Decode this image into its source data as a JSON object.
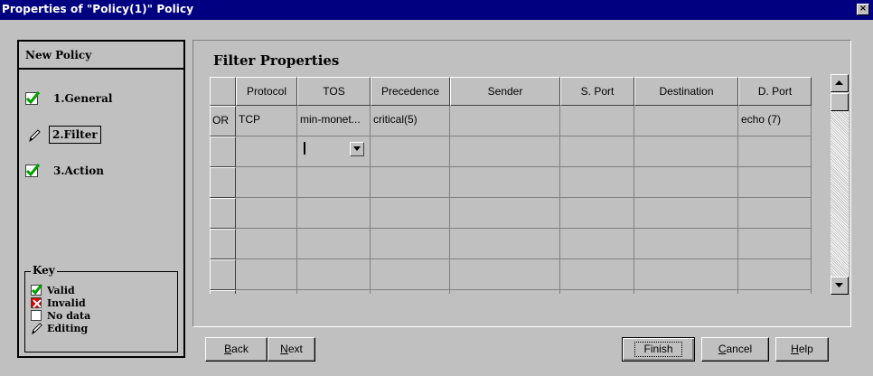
{
  "window": {
    "title": "Properties of \"Policy(1)\" Policy",
    "close_glyph": "×"
  },
  "wizard": {
    "heading": "New Policy",
    "steps": [
      {
        "label": "1.General",
        "status": "valid",
        "icon": "valid-check-icon"
      },
      {
        "label": "2.Filter",
        "status": "editing",
        "icon": "pencil-icon"
      },
      {
        "label": "3.Action",
        "status": "valid",
        "icon": "valid-check-icon"
      }
    ]
  },
  "key": {
    "title": "Key",
    "items": [
      {
        "label": "Valid",
        "icon": "valid-check-icon"
      },
      {
        "label": "Invalid",
        "icon": "invalid-x-icon"
      },
      {
        "label": "No data",
        "icon": "empty-box-icon"
      },
      {
        "label": "Editing",
        "icon": "pencil-icon"
      }
    ]
  },
  "filter": {
    "title": "Filter Properties",
    "columns": [
      "Protocol",
      "TOS",
      "Precedence",
      "Sender",
      "S. Port",
      "Destination",
      "D. Port"
    ],
    "rows": [
      {
        "header": "OR",
        "cells": [
          "TCP",
          "min-monet...",
          "critical(5)",
          "",
          "",
          "",
          "echo (7)"
        ]
      },
      {
        "header": "",
        "cells": [
          "",
          "",
          "",
          "",
          "",
          "",
          ""
        ]
      },
      {
        "header": "",
        "cells": [
          "",
          "",
          "",
          "",
          "",
          "",
          ""
        ]
      },
      {
        "header": "",
        "cells": [
          "",
          "",
          "",
          "",
          "",
          "",
          ""
        ]
      },
      {
        "header": "",
        "cells": [
          "",
          "",
          "",
          "",
          "",
          "",
          ""
        ]
      },
      {
        "header": "",
        "cells": [
          "",
          "",
          "",
          "",
          "",
          "",
          ""
        ]
      },
      {
        "header": "",
        "cells": [
          "",
          "",
          "",
          "",
          "",
          "",
          ""
        ]
      }
    ]
  },
  "buttons": {
    "back": {
      "prefix": "",
      "mnemonic": "B",
      "rest": "ack"
    },
    "next": {
      "prefix": "",
      "mnemonic": "N",
      "rest": "ext"
    },
    "finish": {
      "label": "Finish"
    },
    "cancel": {
      "prefix": "",
      "mnemonic": "C",
      "rest": "ancel"
    },
    "help": {
      "prefix": "",
      "mnemonic": "H",
      "rest": "elp"
    }
  },
  "colors": {
    "titlebar": "#000080",
    "face": "#c0c0c0",
    "valid_green": "#00a000",
    "invalid_red": "#e00000"
  }
}
